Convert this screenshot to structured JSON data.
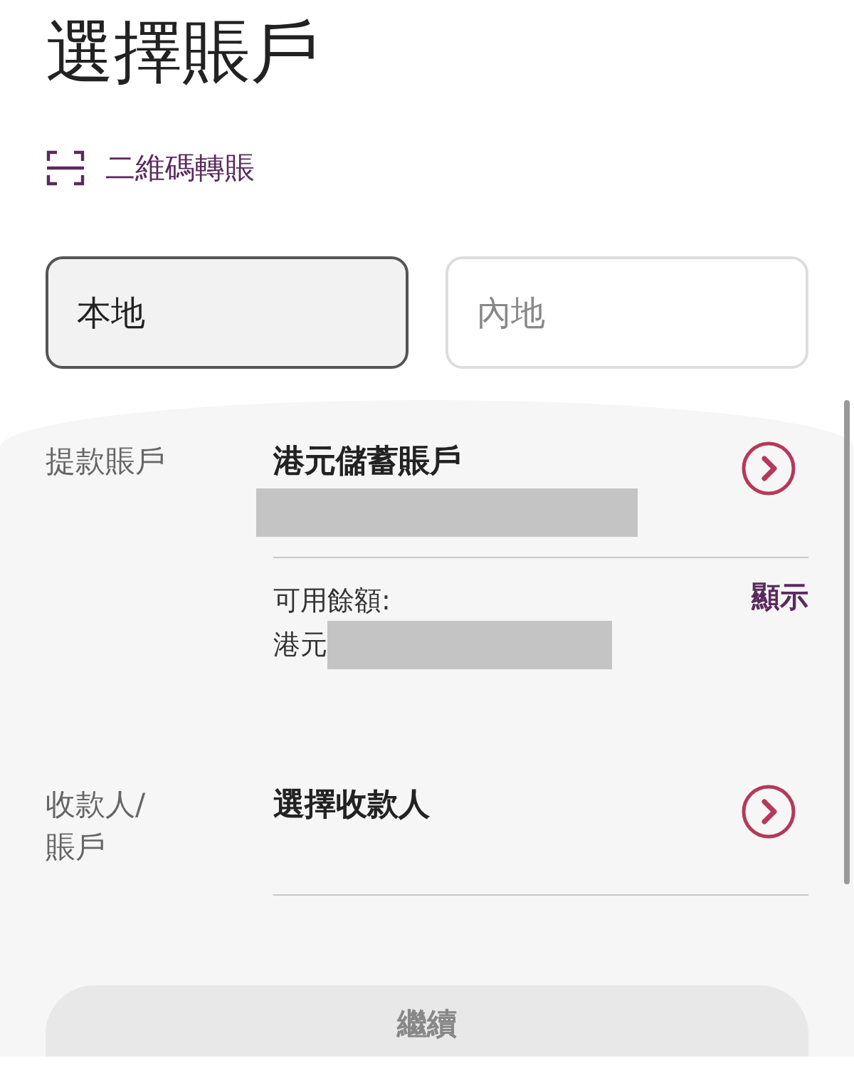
{
  "title": "選擇賬戶",
  "qr_transfer": {
    "label": "二維碼轉賬"
  },
  "tabs": [
    {
      "label": "本地",
      "selected": true
    },
    {
      "label": "內地",
      "selected": false
    }
  ],
  "from_account": {
    "label": "提款賬戶",
    "account_name": "港元儲蓄賬戶",
    "account_number_hidden": true,
    "balance_label": "可用餘額:",
    "show_link": "顯示",
    "currency": "港元",
    "balance_hidden": true
  },
  "payee": {
    "label": "收款人/賬戶",
    "placeholder": "選擇收款人"
  },
  "continue_button": {
    "label": "繼續",
    "disabled": true
  }
}
